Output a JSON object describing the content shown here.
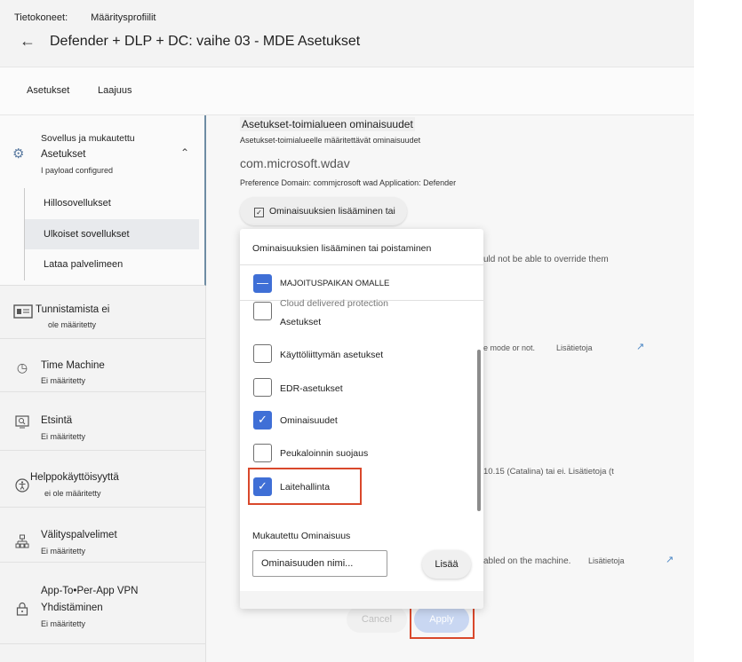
{
  "header": {
    "breadcrumb": [
      "Tietokoneet:",
      "Määritysprofiilit"
    ],
    "back_icon": "arrow-left-icon",
    "title": "Defender + DLP + DC: vaihe 03 - MDE Asetukset"
  },
  "tabs": [
    {
      "label": "Asetukset",
      "active": true
    },
    {
      "label": "Laajuus",
      "active": false
    }
  ],
  "sidebar": {
    "group": {
      "icon": "gear-icon",
      "line1": "Sovellus ja mukautettu",
      "line2": "Asetukset",
      "status": "I payload configured",
      "subitems": [
        "Hillosovellukset",
        "Ulkoiset sovellukset",
        "Lataa palvelimeen"
      ]
    },
    "items": [
      {
        "icon": "id-card-icon",
        "title": "Tunnistamista ei",
        "status": "ole määritetty"
      },
      {
        "icon": "clock-icon",
        "title": "Time Machine",
        "status": "Ei määritetty"
      },
      {
        "icon": "search-icon",
        "title": "Etsintä",
        "status": "Ei määritetty"
      },
      {
        "icon": "accessibility-icon",
        "title": "Helppokäyttöisyyttä",
        "status": "ei ole määritetty"
      },
      {
        "icon": "network-icon",
        "title": "Välityspalvelimet",
        "status": "Ei määritetty"
      },
      {
        "icon": "lock-icon",
        "title": "App-To•Per-App VPN",
        "title2": "Yhdistäminen",
        "status": "Ei määritetty"
      }
    ]
  },
  "content": {
    "heading": "Asetukset-toimialueen ominaisuudet",
    "description": "Asetukset-toimialueelle määritettävät ominaisuudet",
    "domain": "com.microsoft.wdav",
    "preference": "Preference Domain: commjcrosoft wad Application: Defender",
    "add_remove_label": "Ominaisuuksien lisääminen tai poistaminen",
    "bg_texts": [
      "uld not be able to override them",
      "e mode or not.",
      "Lisätietoja",
      "10.15 (Catalina) tai ei. Lisätietoja (t",
      "abled on the machine.",
      "Lisätietoja"
    ],
    "cancel_label": "Cancel",
    "apply_label": "Apply"
  },
  "dropdown": {
    "title": "Ominaisuuksien lisääminen tai poistaminen",
    "select_all_label": "MAJOITUSPAIKAN OMALLE",
    "options": [
      {
        "label": "Cloud delivered protection",
        "checked": false
      },
      {
        "label": "Asetukset",
        "checked": false
      },
      {
        "label": "Käyttöliittymän asetukset",
        "checked": false
      },
      {
        "label": "EDR-asetukset",
        "checked": false
      },
      {
        "label": "Ominaisuudet",
        "checked": true
      },
      {
        "label": "Peukaloinnin suojaus",
        "checked": false
      },
      {
        "label": "Laitehallinta",
        "checked": true
      }
    ],
    "custom_label": "Mukautettu Ominaisuus",
    "custom_input_value": "Ominaisuuden nimi...",
    "add_label": "Lisää"
  },
  "colors": {
    "accent": "#3f6fd6",
    "highlight": "#d9482b",
    "link": "#4a86c5"
  }
}
